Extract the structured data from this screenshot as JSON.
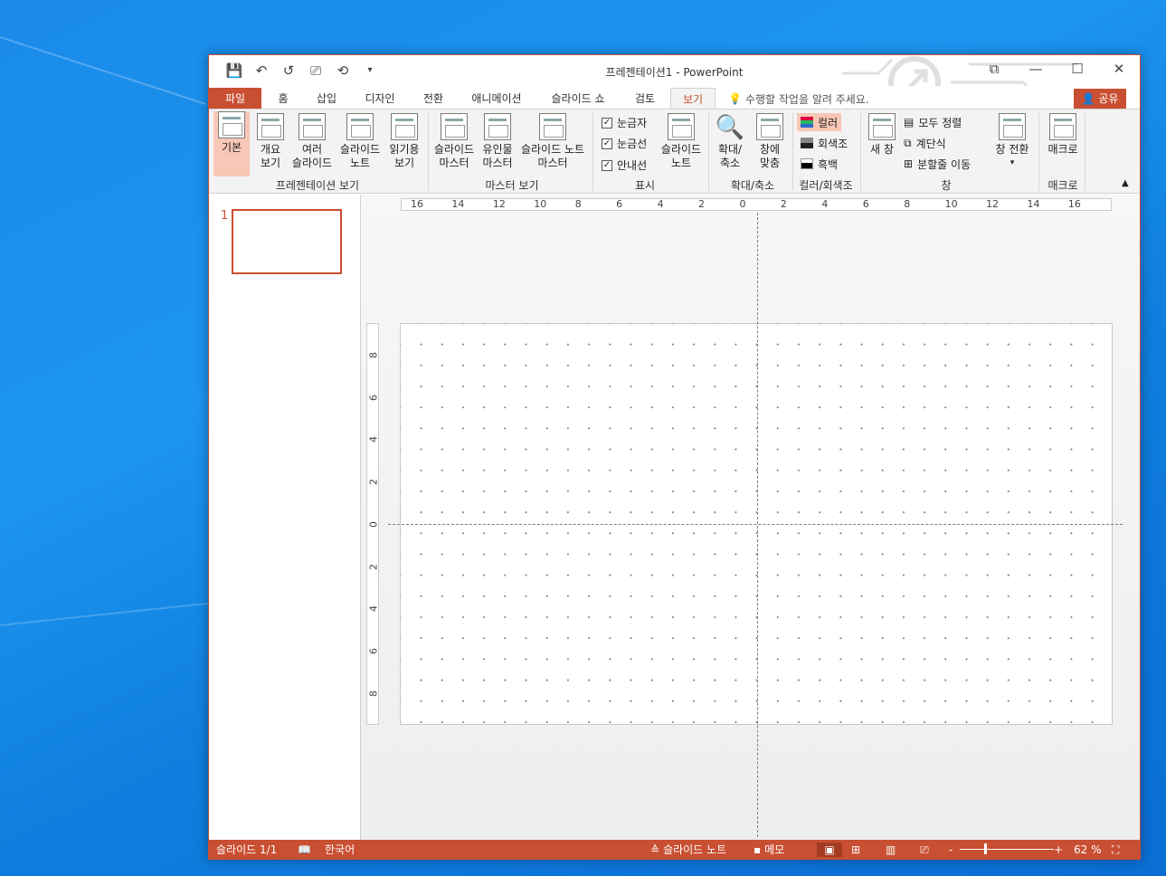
{
  "window": {
    "title": "프레젠테이션1 - PowerPoint",
    "controls": [
      "⧉",
      "—",
      "☐",
      "✕"
    ]
  },
  "qat": [
    "💾",
    "↶",
    "↺",
    "⎚",
    "⟲",
    "▾"
  ],
  "tabs": {
    "file": "파일",
    "items": [
      "홈",
      "삽입",
      "디자인",
      "전환",
      "애니메이션",
      "슬라이드 쇼",
      "검토",
      "보기"
    ],
    "tellme": "수행할 작업을 알려 주세요.",
    "share": "공유"
  },
  "ribbon": {
    "pres_views": [
      "기본",
      "개요\n보기",
      "여러\n슬라이드",
      "슬라이드\n노트",
      "읽기용\n보기"
    ],
    "pres_group": "프레젠테이션 보기",
    "master_views": [
      "슬라이드\n마스터",
      "유인물\n마스터",
      "슬라이드 노트\n마스터"
    ],
    "master_group": "마스터 보기",
    "show": {
      "ruler": "눈금자",
      "gridlines": "눈금선",
      "guides": "안내선",
      "notes": "슬라이드\n노트",
      "group": "표시"
    },
    "zoom": {
      "zoom": "확대/\n축소",
      "fit": "창에\n맞춤",
      "group": "확대/축소"
    },
    "color": {
      "color": "컬러",
      "gray": "회색조",
      "bw": "흑백",
      "group": "컬러/회색조"
    },
    "window": {
      "new": "새 창",
      "arrange": "모두 정렬",
      "cascade": "계단식",
      "split": "분할줄 이동",
      "switch": "창 전환",
      "group": "창"
    },
    "macro": {
      "macro": "매크로",
      "group": "매크로"
    }
  },
  "slides": {
    "num": "1"
  },
  "ruler": {
    "h": [
      "16",
      "14",
      "12",
      "10",
      "8",
      "6",
      "4",
      "2",
      "0",
      "2",
      "4",
      "6",
      "8",
      "10",
      "12",
      "14",
      "16"
    ],
    "v": [
      "8",
      "6",
      "4",
      "2",
      "0",
      "2",
      "4",
      "6",
      "8"
    ]
  },
  "status": {
    "slide": "슬라이드 1/1",
    "lang": "한국어",
    "notes": "슬라이드 노트",
    "comments": "메모",
    "zoom": "62 %"
  }
}
